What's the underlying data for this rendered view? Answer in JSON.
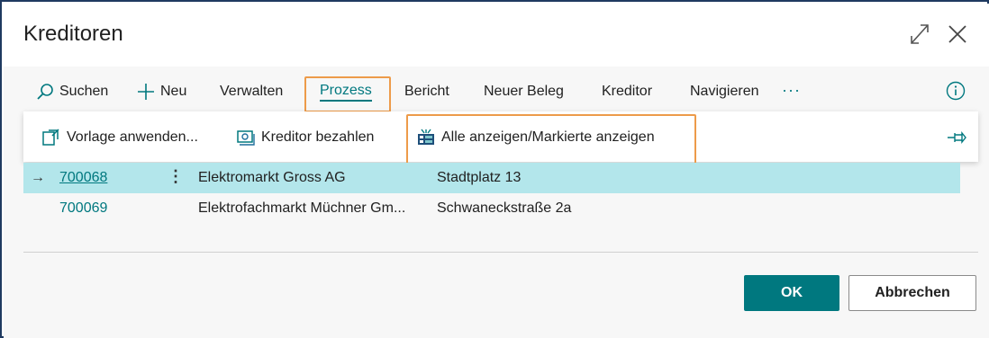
{
  "window": {
    "title": "Kreditoren"
  },
  "actions": {
    "search": "Suchen",
    "new": "Neu",
    "manage": "Verwalten",
    "process": "Prozess",
    "report": "Bericht",
    "new_document": "Neuer Beleg",
    "vendor": "Kreditor",
    "navigate": "Navigieren",
    "more": "···"
  },
  "process_menu": {
    "apply_template": "Vorlage anwenden...",
    "pay_vendor": "Kreditor bezahlen",
    "show_all_marked": "Alle anzeigen/Markierte anzeigen"
  },
  "list": {
    "rows": [
      {
        "no": "700068",
        "name": "Elektromarkt Gross AG",
        "address": "Stadtplatz 13",
        "selected": true
      },
      {
        "no": "700069",
        "name": "Elektrofachmarkt Müchner Gm...",
        "address": "Schwaneckstraße 2a",
        "selected": false
      }
    ]
  },
  "buttons": {
    "ok": "OK",
    "cancel": "Abbrechen"
  },
  "colors": {
    "accent": "#00787f",
    "selection": "#b3e6eb",
    "highlight": "#ed9b4a",
    "frame": "#1f3a60"
  }
}
